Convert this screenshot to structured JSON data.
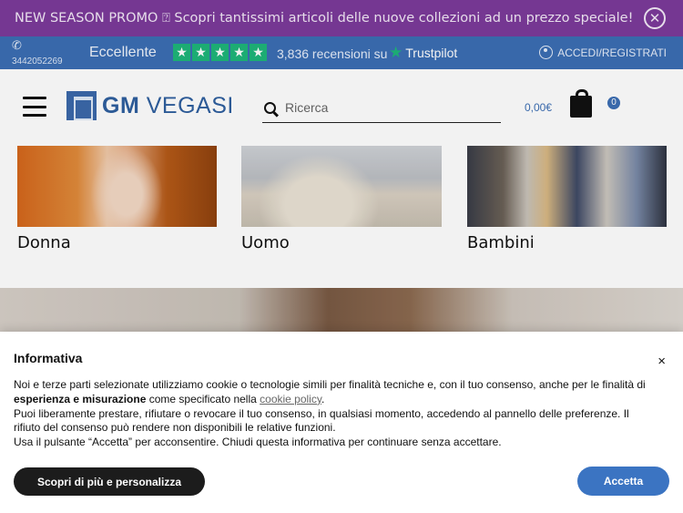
{
  "promo": {
    "text": "NEW SEASON PROMO ⍰ Scopri tantissimi articoli delle nuove collezioni ad un prezzo speciale!",
    "close_icon": "close-circle-icon",
    "color": "#7c3a9a"
  },
  "topbar": {
    "phone_icon": "phone-icon",
    "phone": "3442052269",
    "trustpilot_rating": "Eccellente",
    "stars": 5,
    "reviews": "3,836 recensioni su",
    "trustpilot_label": "Trustpilot",
    "login_label": "ACCEDI/REGISTRATI",
    "color": "#3c6eb4"
  },
  "header": {
    "logo_bold": "GM",
    "logo_rest": "VEGASI",
    "search_placeholder": "Ricerca",
    "cart_total": "0,00€",
    "cart_count": "0"
  },
  "categories": [
    {
      "label": "Donna"
    },
    {
      "label": "Uomo"
    },
    {
      "label": "Bambini"
    }
  ],
  "cookie": {
    "title": "Informativa",
    "close": "×",
    "line1_a": "Noi e terze parti selezionate utilizziamo cookie o tecnologie simili per finalità tecniche e, con il tuo consenso, anche per le finalità di",
    "line1_b_bold": "esperienza e misurazione",
    "line1_c": " come specificato nella ",
    "line1_link": "cookie policy",
    "line1_end": ".",
    "line2": "Puoi liberamente prestare, rifiutare o revocare il tuo consenso, in qualsiasi momento, accedendo al pannello delle preferenze. Il rifiuto del consenso può rendere non disponibili le relative funzioni.",
    "line3": "Usa il pulsante “Accetta” per acconsentire. Chiudi questa informativa per continuare senza accettare.",
    "more_button": "Scopri di più e personalizza",
    "accept_button": "Accetta",
    "accept_color": "#3b74c2"
  }
}
